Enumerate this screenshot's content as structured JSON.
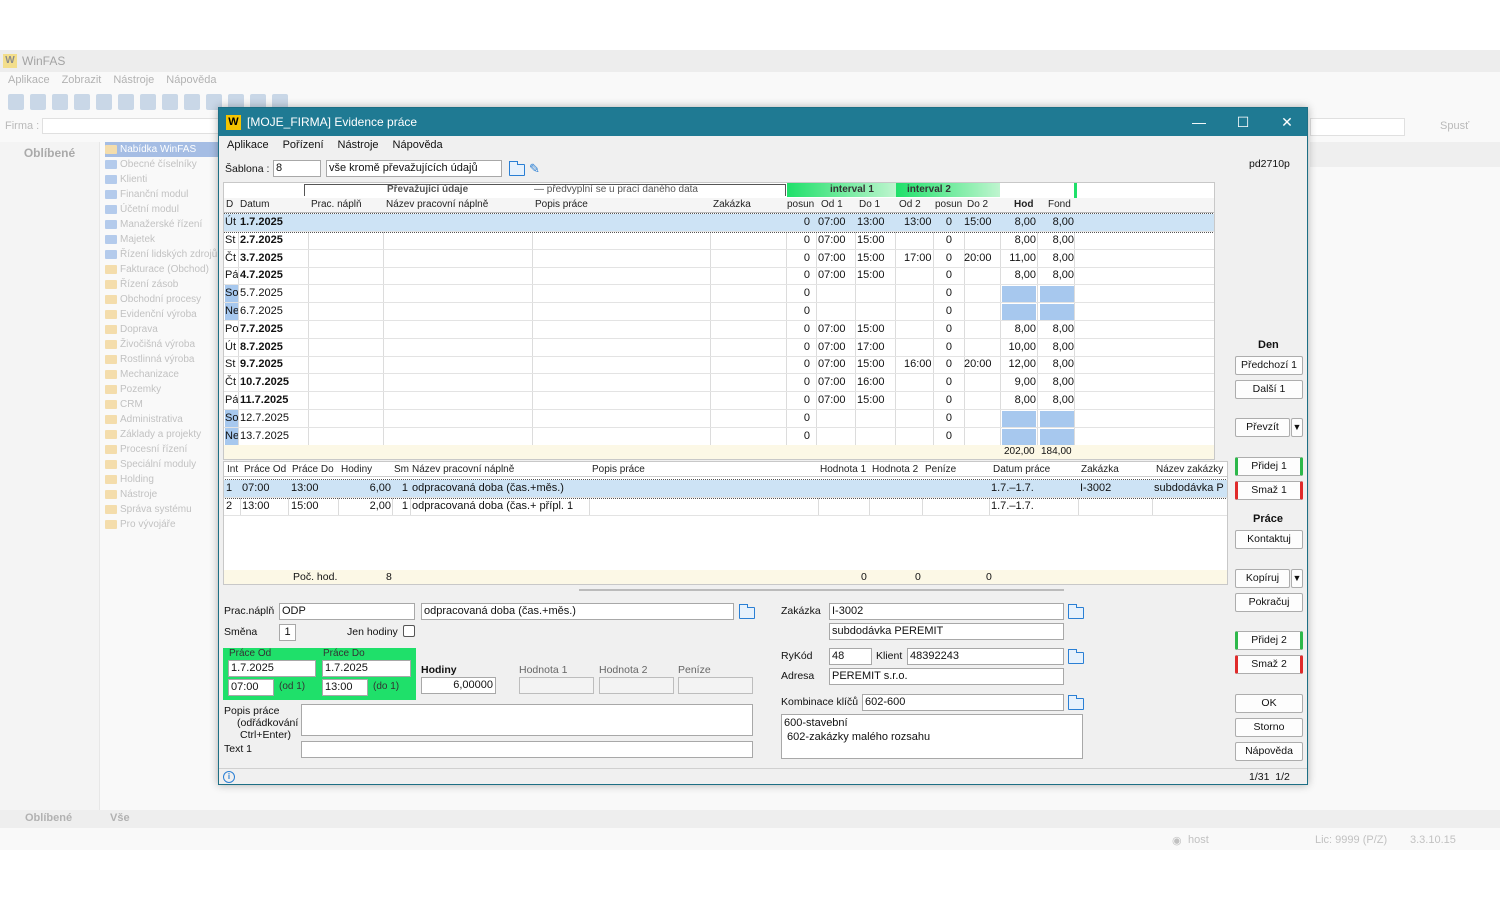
{
  "bg": {
    "app_title": "WinFAS",
    "logo": "W",
    "menu": [
      "Aplikace",
      "Zobrazit",
      "Nástroje",
      "Nápověda"
    ],
    "firma_label": "Firma :",
    "spust": "Spusť",
    "left_title": "Oblíbené",
    "tree": [
      "Nabídka WinFAS",
      "Obecné číselníky",
      "Klienti",
      "Finanční modul",
      "Účetní modul",
      "Manažerské řízení",
      "Majetek",
      "Řízení lidských zdrojů",
      "Fakturace (Obchod)",
      "Řízení zásob",
      "Obchodní procesy",
      "Evidenční výroba",
      "Doprava",
      "Živočišná výroba",
      "Rostlinná výroba",
      "Mechanizace",
      "Pozemky",
      "CRM",
      "Administrativa",
      "Základy a projekty",
      "Procesní řízení",
      "Speciální moduly",
      "Holding",
      "Nástroje",
      "Správa systému",
      "Pro vývojáře"
    ],
    "bottom_tabs": [
      "Oblíbené",
      "Vše"
    ],
    "status_user": "host",
    "status_lic": "Lic: 9999 (P/Z)",
    "status_ver": "3.3.10.15"
  },
  "dialog": {
    "logo": "W",
    "title": "[MOJE_FIRMA] Evidence práce",
    "menu": [
      "Aplikace",
      "Pořízení",
      "Nástroje",
      "Nápověda"
    ],
    "sablona_label": "Šablona :",
    "sablona_value": "8",
    "sablona_text": "vše kromě převažujících údajů",
    "pd": "pd2710p",
    "grid_headers": {
      "prevaz": "Převažující údaje",
      "predvyplni": "— předvyplní se u prací daného data",
      "interval1": "interval 1",
      "interval2": "interval 2",
      "d": "D",
      "datum": "Datum",
      "prac_napln": "Prac. náplň",
      "nazev_napln": "Název pracovní náplně",
      "popis": "Popis práce",
      "zakazka": "Zakázka",
      "posun": "posun",
      "od1": "Od 1",
      "do1": "Do 1",
      "od2": "Od 2",
      "posun2": "posun",
      "do2": "Do 2",
      "hod": "Hod",
      "fond": "Fond"
    },
    "days": [
      {
        "d": "Út",
        "date": "1.7.2025",
        "bold": true,
        "weekend": false,
        "posun": "0",
        "od1": "07:00",
        "do1": "13:00",
        "od2": "13:00",
        "posun2": "0",
        "do2": "15:00",
        "hod": "8,00",
        "fond": "8,00"
      },
      {
        "d": "St",
        "date": "2.7.2025",
        "bold": true,
        "weekend": false,
        "posun": "0",
        "od1": "07:00",
        "do1": "15:00",
        "od2": "",
        "posun2": "0",
        "do2": "",
        "hod": "8,00",
        "fond": "8,00"
      },
      {
        "d": "Čt",
        "date": "3.7.2025",
        "bold": true,
        "weekend": false,
        "posun": "0",
        "od1": "07:00",
        "do1": "15:00",
        "od2": "17:00",
        "posun2": "0",
        "do2": "20:00",
        "hod": "11,00",
        "fond": "8,00"
      },
      {
        "d": "Pá",
        "date": "4.7.2025",
        "bold": true,
        "weekend": false,
        "posun": "0",
        "od1": "07:00",
        "do1": "15:00",
        "od2": "",
        "posun2": "0",
        "do2": "",
        "hod": "8,00",
        "fond": "8,00"
      },
      {
        "d": "So",
        "date": "5.7.2025",
        "bold": false,
        "weekend": true,
        "posun": "0",
        "od1": "",
        "do1": "",
        "od2": "",
        "posun2": "0",
        "do2": "",
        "hod": "",
        "fond": ""
      },
      {
        "d": "Ne",
        "date": "6.7.2025",
        "bold": false,
        "weekend": true,
        "posun": "0",
        "od1": "",
        "do1": "",
        "od2": "",
        "posun2": "0",
        "do2": "",
        "hod": "",
        "fond": ""
      },
      {
        "d": "Po",
        "date": "7.7.2025",
        "bold": true,
        "weekend": false,
        "posun": "0",
        "od1": "07:00",
        "do1": "15:00",
        "od2": "",
        "posun2": "0",
        "do2": "",
        "hod": "8,00",
        "fond": "8,00"
      },
      {
        "d": "Út",
        "date": "8.7.2025",
        "bold": true,
        "weekend": false,
        "posun": "0",
        "od1": "07:00",
        "do1": "17:00",
        "od2": "",
        "posun2": "0",
        "do2": "",
        "hod": "10,00",
        "fond": "8,00"
      },
      {
        "d": "St",
        "date": "9.7.2025",
        "bold": true,
        "weekend": false,
        "posun": "0",
        "od1": "07:00",
        "do1": "15:00",
        "od2": "16:00",
        "posun2": "0",
        "do2": "20:00",
        "hod": "12,00",
        "fond": "8,00"
      },
      {
        "d": "Čt",
        "date": "10.7.2025",
        "bold": true,
        "weekend": false,
        "posun": "0",
        "od1": "07:00",
        "do1": "16:00",
        "od2": "",
        "posun2": "0",
        "do2": "",
        "hod": "9,00",
        "fond": "8,00"
      },
      {
        "d": "Pá",
        "date": "11.7.2025",
        "bold": true,
        "weekend": false,
        "posun": "0",
        "od1": "07:00",
        "do1": "15:00",
        "od2": "",
        "posun2": "0",
        "do2": "",
        "hod": "8,00",
        "fond": "8,00"
      },
      {
        "d": "So",
        "date": "12.7.2025",
        "bold": false,
        "weekend": true,
        "posun": "0",
        "od1": "",
        "do1": "",
        "od2": "",
        "posun2": "0",
        "do2": "",
        "hod": "",
        "fond": ""
      },
      {
        "d": "Ne",
        "date": "13.7.2025",
        "bold": false,
        "weekend": true,
        "posun": "0",
        "od1": "",
        "do1": "",
        "od2": "",
        "posun2": "0",
        "do2": "",
        "hod": "",
        "fond": ""
      }
    ],
    "totals": {
      "hod": "202,00",
      "fond": "184,00"
    },
    "grid2_headers": {
      "int": "Int",
      "prace_od": "Práce Od",
      "prace_do": "Práce Do",
      "hodiny": "Hodiny",
      "sm": "Sm",
      "nazev": "Název pracovní náplně",
      "popis": "Popis práce",
      "hodnota1": "Hodnota 1",
      "hodnota2": "Hodnota 2",
      "penize": "Peníze",
      "datum_prace": "Datum práce",
      "zakazka": "Zakázka",
      "nazev_zakazky": "Název zakázky"
    },
    "works": [
      {
        "int": "1",
        "od": "07:00",
        "do": "13:00",
        "hodiny": "6,00",
        "sm": "1",
        "nazev": "odpracovaná doba (čas.+měs.)",
        "datum": "1.7.–1.7.",
        "zakazka": "I-3002",
        "nazev_zakazky": "subdodávka P"
      },
      {
        "int": "2",
        "od": "13:00",
        "do": "15:00",
        "hodiny": "2,00",
        "sm": "1",
        "nazev": "odpracovaná doba (čas.+ přípl. 1",
        "datum": "1.7.–1.7.",
        "zakazka": "",
        "nazev_zakazky": ""
      }
    ],
    "footer": {
      "poc_hod_label": "Poč. hod.",
      "poc_hod": "8",
      "h1": "0",
      "h2": "0",
      "penize": "0"
    },
    "form": {
      "prac_napln_label": "Prac.náplň",
      "prac_napln": "ODP",
      "prac_napln_name": "odpracovaná doba (čas.+měs.)",
      "smena_label": "Směna",
      "smena": "1",
      "jen_hodiny_label": "Jen hodiny",
      "prace_od_label": "Práce Od",
      "prace_od_date": "1.7.2025",
      "prace_od_time": "07:00",
      "od1": "(od 1)",
      "prace_do_label": "Práce Do",
      "prace_do_date": "1.7.2025",
      "prace_do_time": "13:00",
      "do1": "(do 1)",
      "hodiny_label": "Hodiny",
      "hodiny": "6,00000",
      "hodnota1_label": "Hodnota 1",
      "hodnota2_label": "Hodnota 2",
      "penize_label": "Peníze",
      "popis_label": "Popis práce",
      "popis_hint1": "(odřádkování",
      "popis_hint2": "Ctrl+Enter)",
      "text1_label": "Text 1",
      "zakazka_label": "Zakázka",
      "zakazka": "I-3002",
      "zakazka_name": "subdodávka PEREMIT",
      "rykod_label": "RyKód",
      "rykod": "48",
      "klient_label": "Klient",
      "klient": "48392243",
      "adresa_label": "Adresa",
      "adresa": "PEREMIT s.r.o.",
      "kombinace_label": "Kombinace klíčů",
      "kombinace": "602-600",
      "kombinace_line1": "600-stavební",
      "kombinace_line2": " 602-zakázky malého rozsahu"
    },
    "side": {
      "den": "Den",
      "predchozi": "Předchozí 1",
      "dalsi": "Další 1",
      "prevzit": "Převzít",
      "pridej1": "Přidej 1",
      "smaz1": "Smaž 1",
      "prace": "Práce",
      "kontaktuj": "Kontaktuj",
      "kopiruj": "Kopíruj",
      "pokracuj": "Pokračuj",
      "pridej2": "Přidej 2",
      "smaz2": "Smaž 2",
      "ok": "OK",
      "storno": "Storno",
      "napoveda": "Nápověda"
    },
    "status": {
      "info": "i",
      "paging": "1/31  1/2"
    },
    "colors": {
      "title": "#1f7a93",
      "interval": "#1fe06a",
      "weekend": "#a7c8ee",
      "selection": "#cde3f5"
    }
  }
}
